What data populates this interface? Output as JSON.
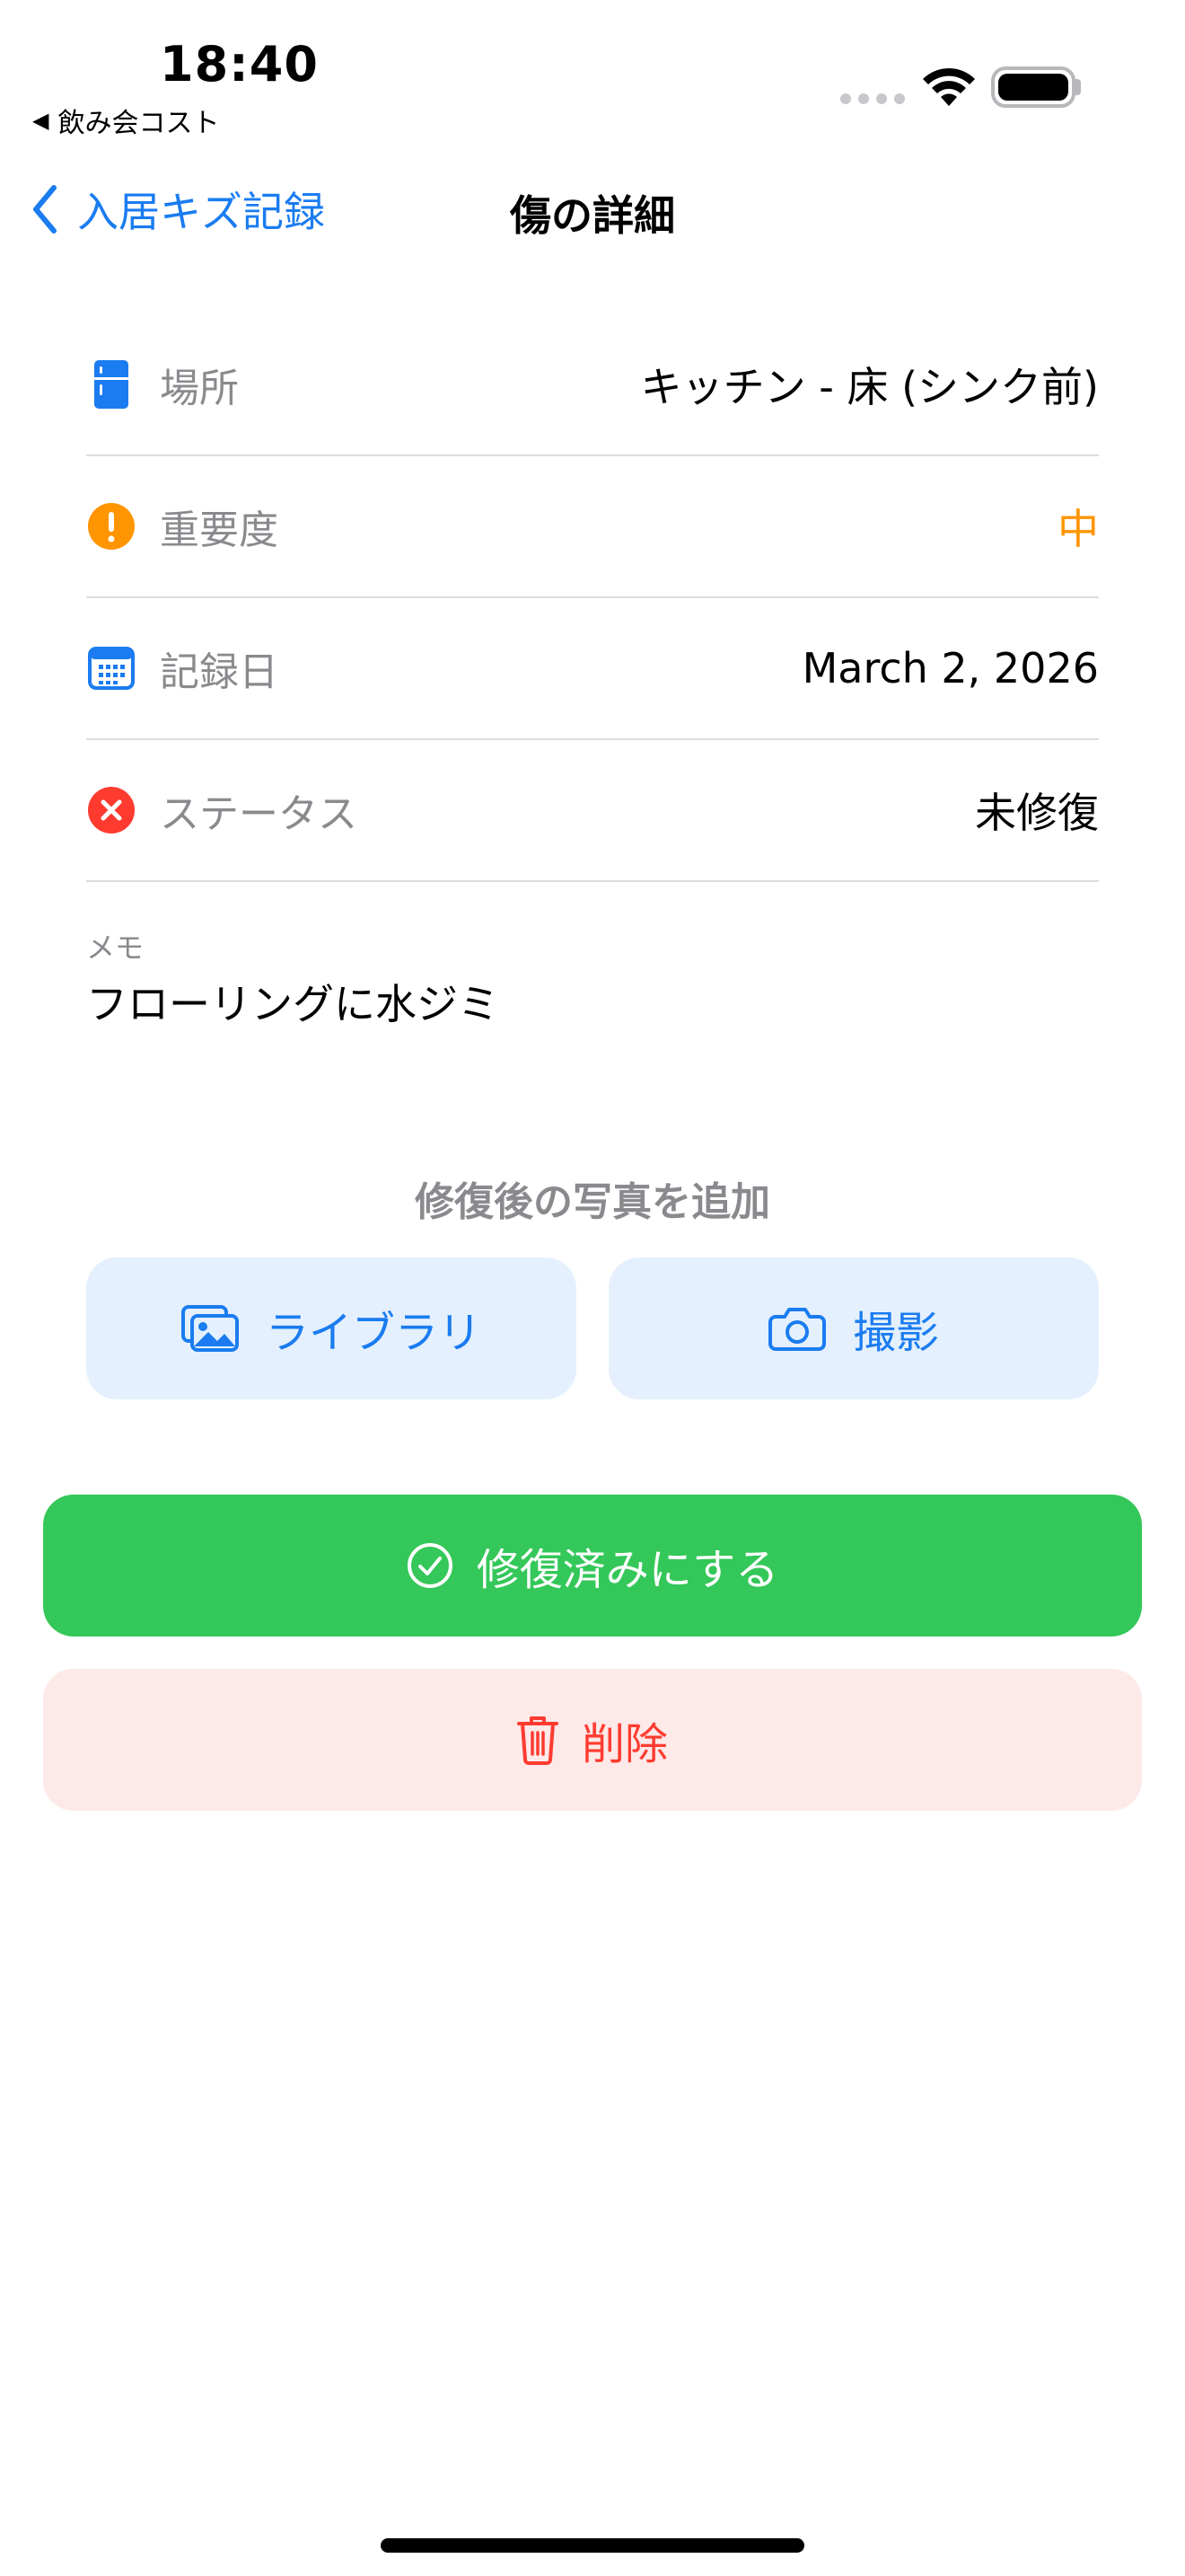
{
  "status_bar": {
    "time": "18:40",
    "back_app": "飲み会コスト",
    "back_arrow": "◀"
  },
  "nav": {
    "back_label": "入居キズ記録",
    "title": "傷の詳細"
  },
  "details": {
    "location": {
      "label": "場所",
      "value": "キッチン - 床 (シンク前)",
      "icon": "refrigerator-icon"
    },
    "severity": {
      "label": "重要度",
      "value": "中",
      "icon": "exclamation-circle-icon",
      "color": "#ff9500"
    },
    "date": {
      "label": "記録日",
      "value": "March 2, 2026",
      "icon": "calendar-icon"
    },
    "status": {
      "label": "ステータス",
      "value": "未修復",
      "icon": "x-circle-icon",
      "color": "#ff3b30"
    }
  },
  "memo": {
    "label": "メモ",
    "text": "フローリングに水ジミ"
  },
  "photo_section": {
    "heading": "修復後の写真を追加",
    "library_label": "ライブラリ",
    "camera_label": "撮影"
  },
  "actions": {
    "repair_label": "修復済みにする",
    "delete_label": "削除"
  },
  "colors": {
    "accent": "#1a7cf0",
    "success": "#34c759",
    "danger": "#ff3b30",
    "warning": "#ff9500"
  }
}
